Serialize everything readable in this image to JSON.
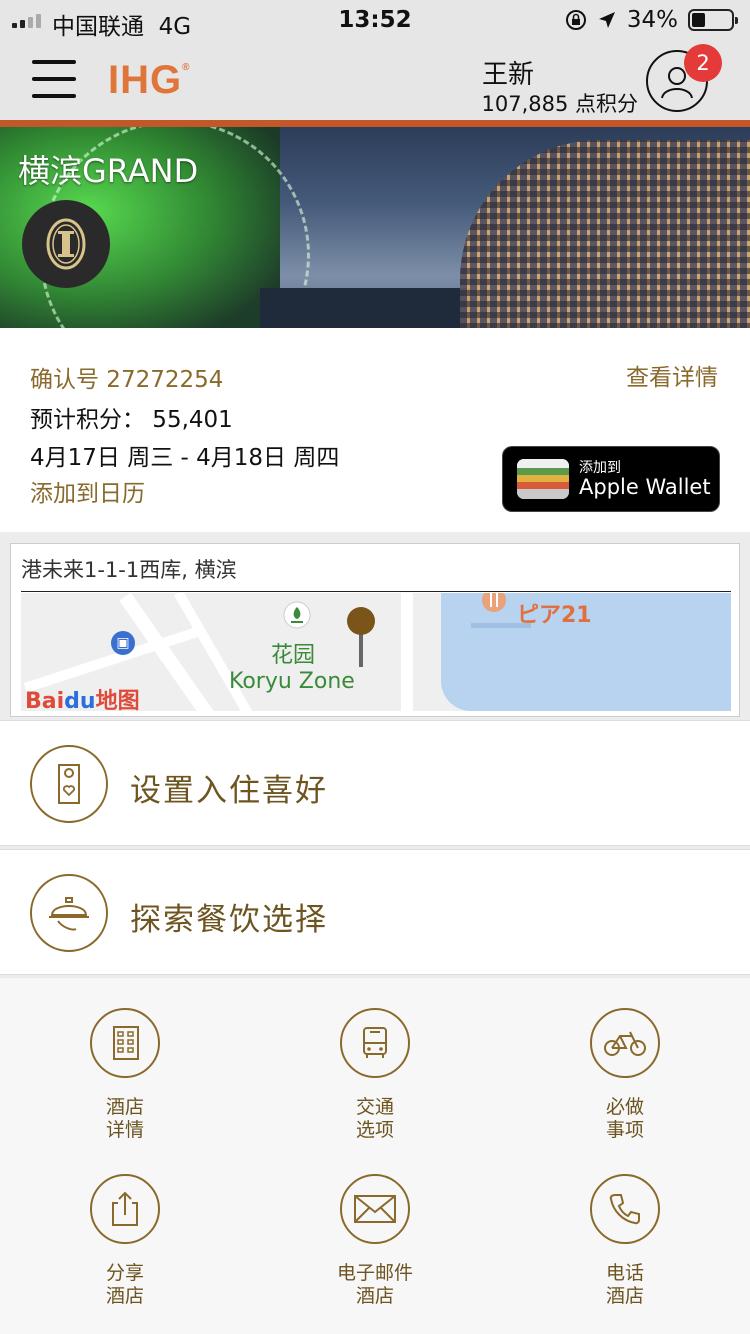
{
  "status_bar": {
    "carrier": "中国联通",
    "network": "4G",
    "time": "13:52",
    "battery": "34%",
    "battery_level": 0.34
  },
  "header": {
    "logo": "IHG",
    "user_name": "王新",
    "points": "107,885 点积分",
    "notification_count": "2"
  },
  "hero": {
    "hotel_name": "横滨GRAND"
  },
  "reservation": {
    "confirmation": "确认号 27272254",
    "view_details": "查看详情",
    "estimated_points": "预计积分：  55,401",
    "dates": "4月17日 周三 - 4月18日 周四",
    "add_calendar": "添加到日历",
    "wallet_small": "添加到",
    "wallet_big": "Apple Wallet"
  },
  "map": {
    "address": "港未来1-1-1西库, 横滨",
    "label_pier": "ピア21",
    "label_park": "花园",
    "label_zone": "Koryu Zone",
    "baidu_bai": "Bai",
    "baidu_du": "du",
    "baidu_map": "地图"
  },
  "actions": [
    {
      "label": "设置入住喜好",
      "icon": "door-hanger-icon"
    },
    {
      "label": "探索餐饮选择",
      "icon": "food-cloche-icon"
    }
  ],
  "grid": [
    {
      "line1": "酒店",
      "line2": "详情",
      "icon": "building-icon"
    },
    {
      "line1": "交通",
      "line2": "选项",
      "icon": "bus-icon"
    },
    {
      "line1": "必做",
      "line2": "事项",
      "icon": "bicycle-icon"
    },
    {
      "line1": "分享",
      "line2": "酒店",
      "icon": "share-icon"
    },
    {
      "line1": "电子邮件",
      "line2": "酒店",
      "icon": "envelope-icon"
    },
    {
      "line1": "电话",
      "line2": "酒店",
      "icon": "phone-icon"
    }
  ],
  "colors": {
    "accent_gold": "#8a6a2c",
    "brand_orange": "#e0753a",
    "badge_red": "#e43a3a"
  }
}
